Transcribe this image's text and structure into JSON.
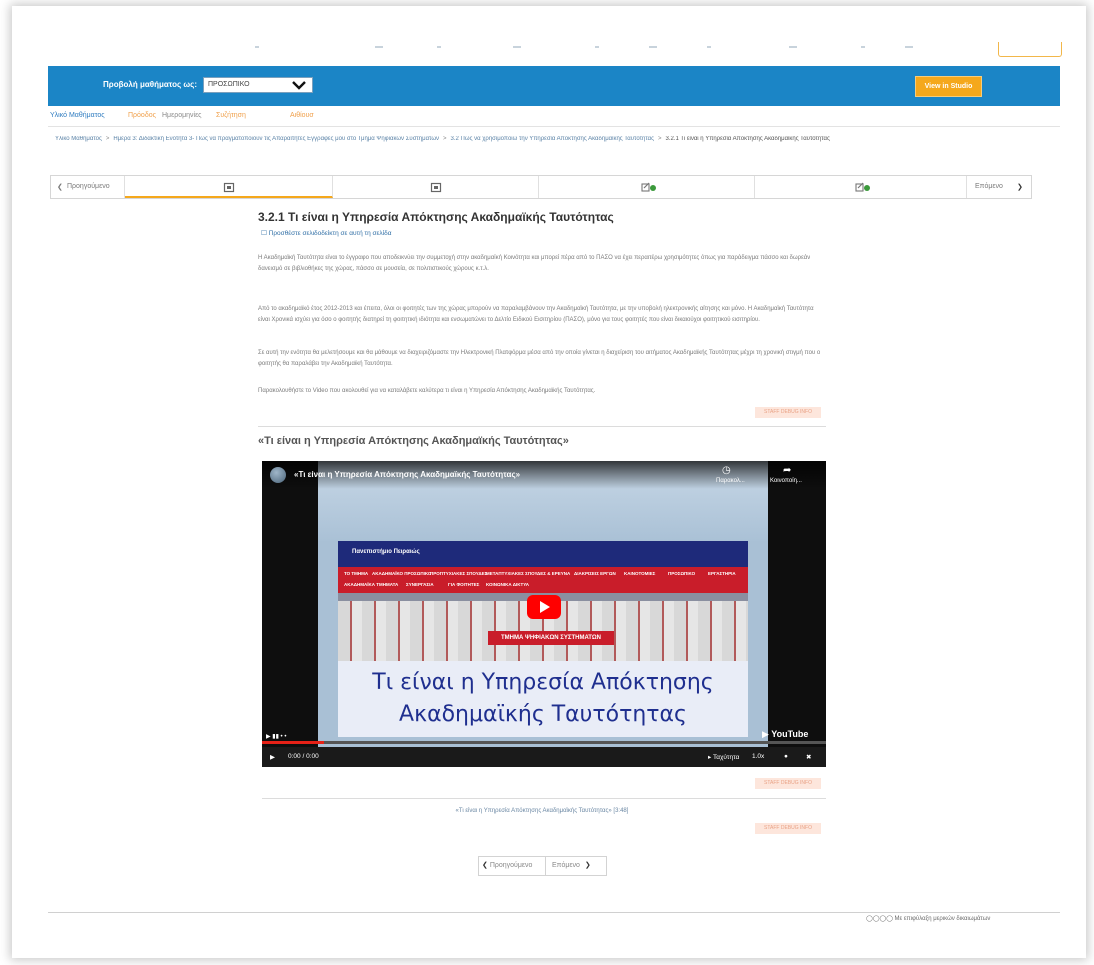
{
  "header": {
    "view_label": "Προβολή μαθήματος ως:",
    "view_value": "ΠΡΟΣΩΠΙΚΟ",
    "studio_button": "View in Studio"
  },
  "course_tabs": [
    {
      "label": "Υλικό Μαθήματος",
      "color": "#2f7cc0"
    },
    {
      "label": "Πρόοδος",
      "color": "#f0a04b"
    },
    {
      "label": "Ημερομηνίες",
      "color": "#8a8a8a"
    },
    {
      "label": "Συζήτηση",
      "color": "#f0a04b"
    },
    {
      "label": "Αιθίουσ",
      "color": "#f0a04b"
    }
  ],
  "breadcrumb": {
    "items": [
      "Υλικό Μαθήματος",
      "Ημέρα 3: Διδακτική Ενότητα 3- Πώς να πραγματοποιούν τις Απαραίτητες Εγγραφές μου στο Τμήμα Ψηφιακών Συστημάτων",
      "3.2 Πώς να χρησιμοποιώ την Υπηρεσία Απόκτησης Ακαδημαϊκής Ταυτότητας"
    ],
    "current": "3.2.1 Τι είναι η Υπηρεσία Απόκτησης Ακαδημαϊκής Ταυτότητας"
  },
  "sequence": {
    "prev_label": "Προηγούμενο",
    "next_label": "Επόμενο"
  },
  "unit": {
    "title": "3.2.1 Τι είναι η Υπηρεσία Απόκτησης Ακαδημαϊκής Ταυτότητας",
    "bookmark": "Προσθέστε σελιδοδείκτη σε αυτή τη σελίδα",
    "paragraphs": [
      "Η Ακαδημαϊκή Ταυτότητα είναι το έγγραφο που αποδεικνύει την συμμετοχή στην ακαδημαϊκή Κοινότητα και μπορεί πέρα από το ΠΑΣΟ να έχει περαιτέρω χρησιμότητες όπως για παράδειγμα πάσσο και δωρεάν δανεισμό σε βιβλιοθήκες της χώρας, πάσσο σε μουσεία, σε πολιτιστικούς χώρους κ.τ.λ.",
      "Από το ακαδημαϊκό έτος 2012-2013 και έπειτα, όλοι οι φοιτητές των της χώρας μπορούν να παραλαμβάνουν την Ακαδημαϊκή Ταυτότητα, με την υποβολή ηλεκτρονικής αίτησης και μόνο. Η Ακαδημαϊκή Ταυτότητα είναι Χρονικά ισχύει για όσο ο φοιτητής διατηρεί τη φοιτητική ιδιότητα και ενσωματώνει το Δελτίο Ειδικού Εισιτηρίου (ΠΑΣΟ), μόνο για τους φοιτητές που είναι δικαιούχοι φοιτητικού εισιτηρίου.",
      "Σε αυτή την ενότητα θα μελετήσουμε και θα μάθουμε να διαχειριζόμαστε την Ηλεκτρονική Πλατφόρμα μέσα από την οποία γίνεται η διαχείριση του αιτήματος Ακαδημαϊκής Ταυτότητας μέχρι τη χρονική στιγμή που ο φοιτητής θα παραλάβει την Ακαδημαϊκή Ταυτότητα.",
      "Παρακολουθήστε το Video που ακολουθεί για να καταλάβετε καλύτερα τι είναι η Υπηρεσία Απόκτησης Ακαδημαϊκής Ταυτότητας."
    ],
    "staff_debug": "STAFF DEBUG INFO"
  },
  "video": {
    "heading": "«Τι είναι η Υπηρεσία Απόκτησης Ακαδημαϊκής Ταυτότητας»",
    "yt_title": "«Τι είναι η Υπηρεσία Απόκτησης Ακαδημαϊκής Ταυτότητας»",
    "watch_later": "Παρακολ...",
    "share": "Κοινοποίη...",
    "site_name": "Πανεπιστήμιο Πειραιώς",
    "site_menu": [
      "ΤΟ ΤΜΗΜΑ",
      "ΑΚΑΔΗΜΑΪΚΟ ΠΡΟΣΩΠΙΚΟ",
      "ΠΡΟΠΤΥΧΙΑΚΕΣ ΣΠΟΥΔΕΣ",
      "ΜΕΤΑΠΤΥΧΙΑΚΕΣ ΣΠΟΥΔΕΣ & ΕΡΕΥΝΑ",
      "ΔΙΑΚΡΙΣΕΙΣ ΕΡΓΩΝ",
      "ΚΑΙΝΟΤΟΜΙΕΣ",
      "ΠΡΟΣΩΠΙΚΟ",
      "ΕΡΓΑΣΤΗΡΙΑ"
    ],
    "site_menu2": [
      "ΑΚΑΔΗΜΑΪΚΑ ΤΜΗΜΑΤΑ",
      "ΣΥΝΕΡΓΑΣΙΑ",
      "ΓΙΑ ΦΟΙΤΗΤΕΣ",
      "ΚΟΙΝΩΝΙΚΑ ΔΙΚΤΥΑ"
    ],
    "red_label": "ΤΜΗΜΑ ΨΗΦΙΑΚΩΝ ΣΥΣΤΗΜΑΤΩΝ",
    "caption": "Τι είναι η Υπηρεσία Απόκτησης Ακαδημαϊκής Ταυτότητας",
    "youtube": "YouTube",
    "time": "0:00 / 0:00",
    "transcript": "Ταχύτητα",
    "speed": "1.0x",
    "progress_percent": 11,
    "caption_link": "«Τι είναι η Υπηρεσία Απόκτησης Ακαδημαϊκής Ταυτότητας» [3:48]"
  },
  "pager": {
    "prev": "Προηγούμενο",
    "next": "Επόμενο"
  },
  "footer": {
    "license": "Με επιφύλαξη μερικών δικαιωμάτων"
  },
  "colors": {
    "brand_blue": "#1b85c6",
    "accent_orange": "#f5a81c",
    "link": "#2f6ea5"
  }
}
